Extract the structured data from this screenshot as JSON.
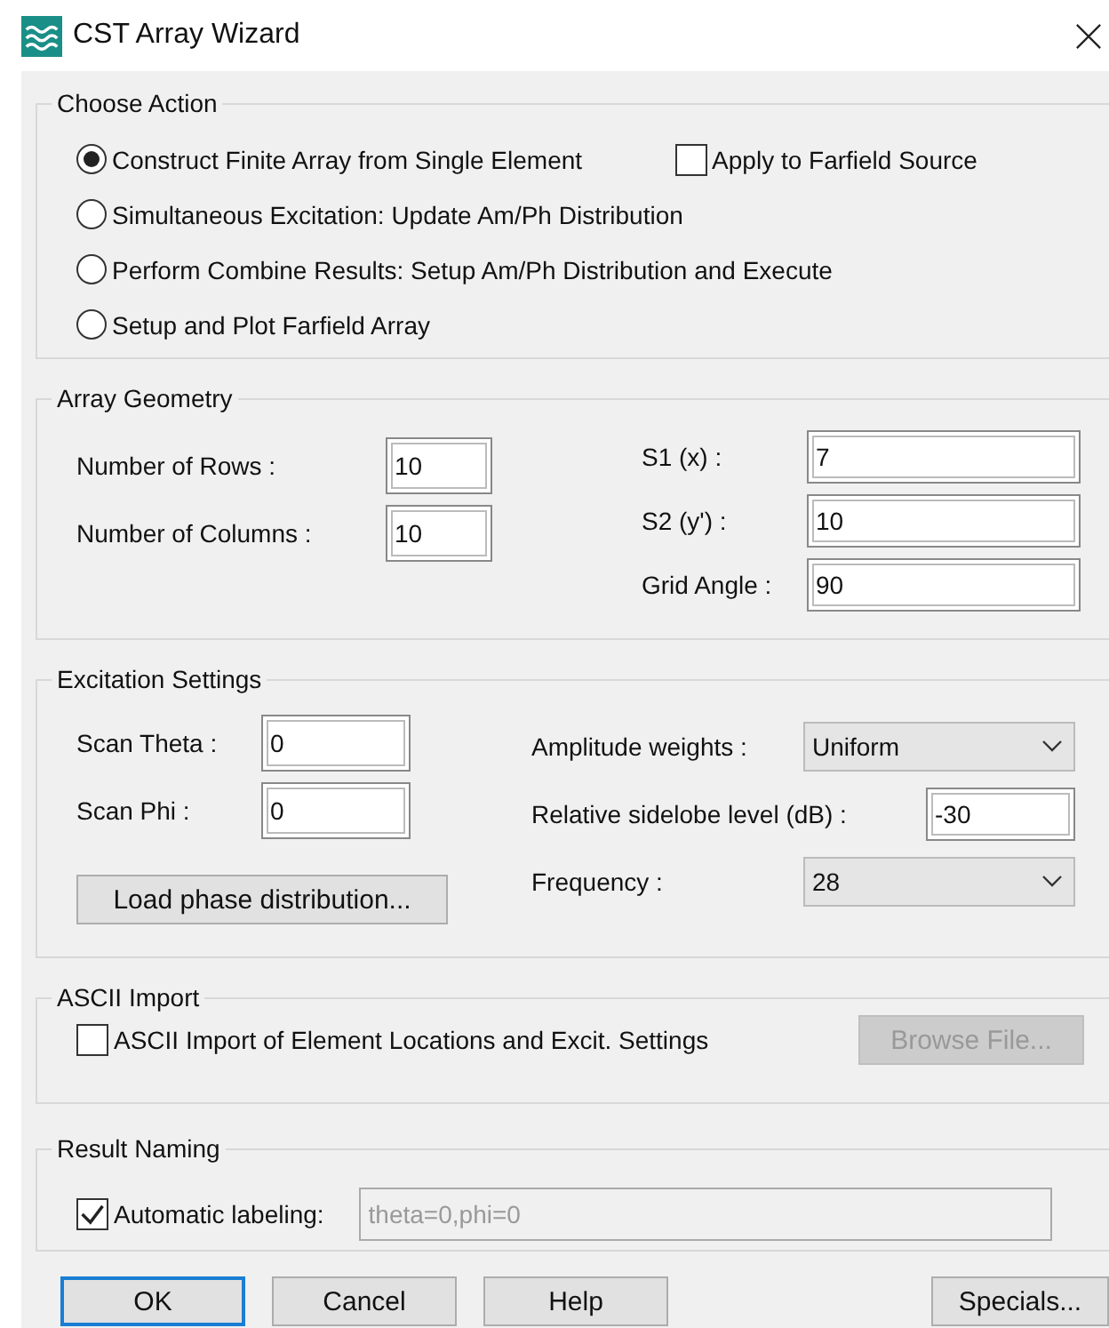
{
  "window": {
    "title": "CST Array Wizard"
  },
  "choose_action": {
    "title": "Choose Action",
    "options": [
      {
        "label": "Construct Finite Array from Single Element",
        "selected": true
      },
      {
        "label": "Simultaneous Excitation: Update Am/Ph Distribution",
        "selected": false
      },
      {
        "label": "Perform Combine Results: Setup Am/Ph Distribution and Execute",
        "selected": false
      },
      {
        "label": "Setup and Plot Farfield Array",
        "selected": false
      }
    ],
    "apply_checkbox": {
      "label": "Apply to Farfield Source",
      "checked": false
    }
  },
  "array_geometry": {
    "title": "Array Geometry",
    "left_fields": [
      {
        "label": "Number of Rows :",
        "value": "10"
      },
      {
        "label": "Number of Columns :",
        "value": "10"
      }
    ],
    "right_fields": [
      {
        "label": "S1 (x) :",
        "value": "7"
      },
      {
        "label": "S2 (y') :",
        "value": "10"
      },
      {
        "label": "Grid Angle :",
        "value": "90"
      }
    ]
  },
  "excitation": {
    "title": "Excitation Settings",
    "left_fields": [
      {
        "label": "Scan Theta :",
        "value": "0"
      },
      {
        "label": "Scan Phi :",
        "value": "0"
      }
    ],
    "load_button": "Load phase distribution...",
    "right_fields": [
      {
        "kind": "dropdown",
        "label": "Amplitude weights :",
        "value": "Uniform"
      },
      {
        "kind": "text",
        "label": "Relative sidelobe level (dB) :",
        "value": "-30"
      },
      {
        "kind": "dropdown",
        "label": "Frequency :",
        "value": "28"
      }
    ]
  },
  "ascii_import": {
    "title": "ASCII Import",
    "checkbox": {
      "label": "ASCII Import of Element Locations and Excit. Settings",
      "checked": false
    },
    "browse_button": {
      "label": "Browse File...",
      "disabled": true
    }
  },
  "result_naming": {
    "title": "Result Naming",
    "checkbox": {
      "label": "Automatic labeling:",
      "checked": true
    },
    "field": {
      "value": "theta=0,phi=0",
      "disabled": true
    }
  },
  "buttons": [
    {
      "label": "OK",
      "default": true
    },
    {
      "label": "Cancel",
      "default": false
    },
    {
      "label": "Help",
      "default": false
    },
    {
      "label": "Specials...",
      "default": false
    }
  ]
}
